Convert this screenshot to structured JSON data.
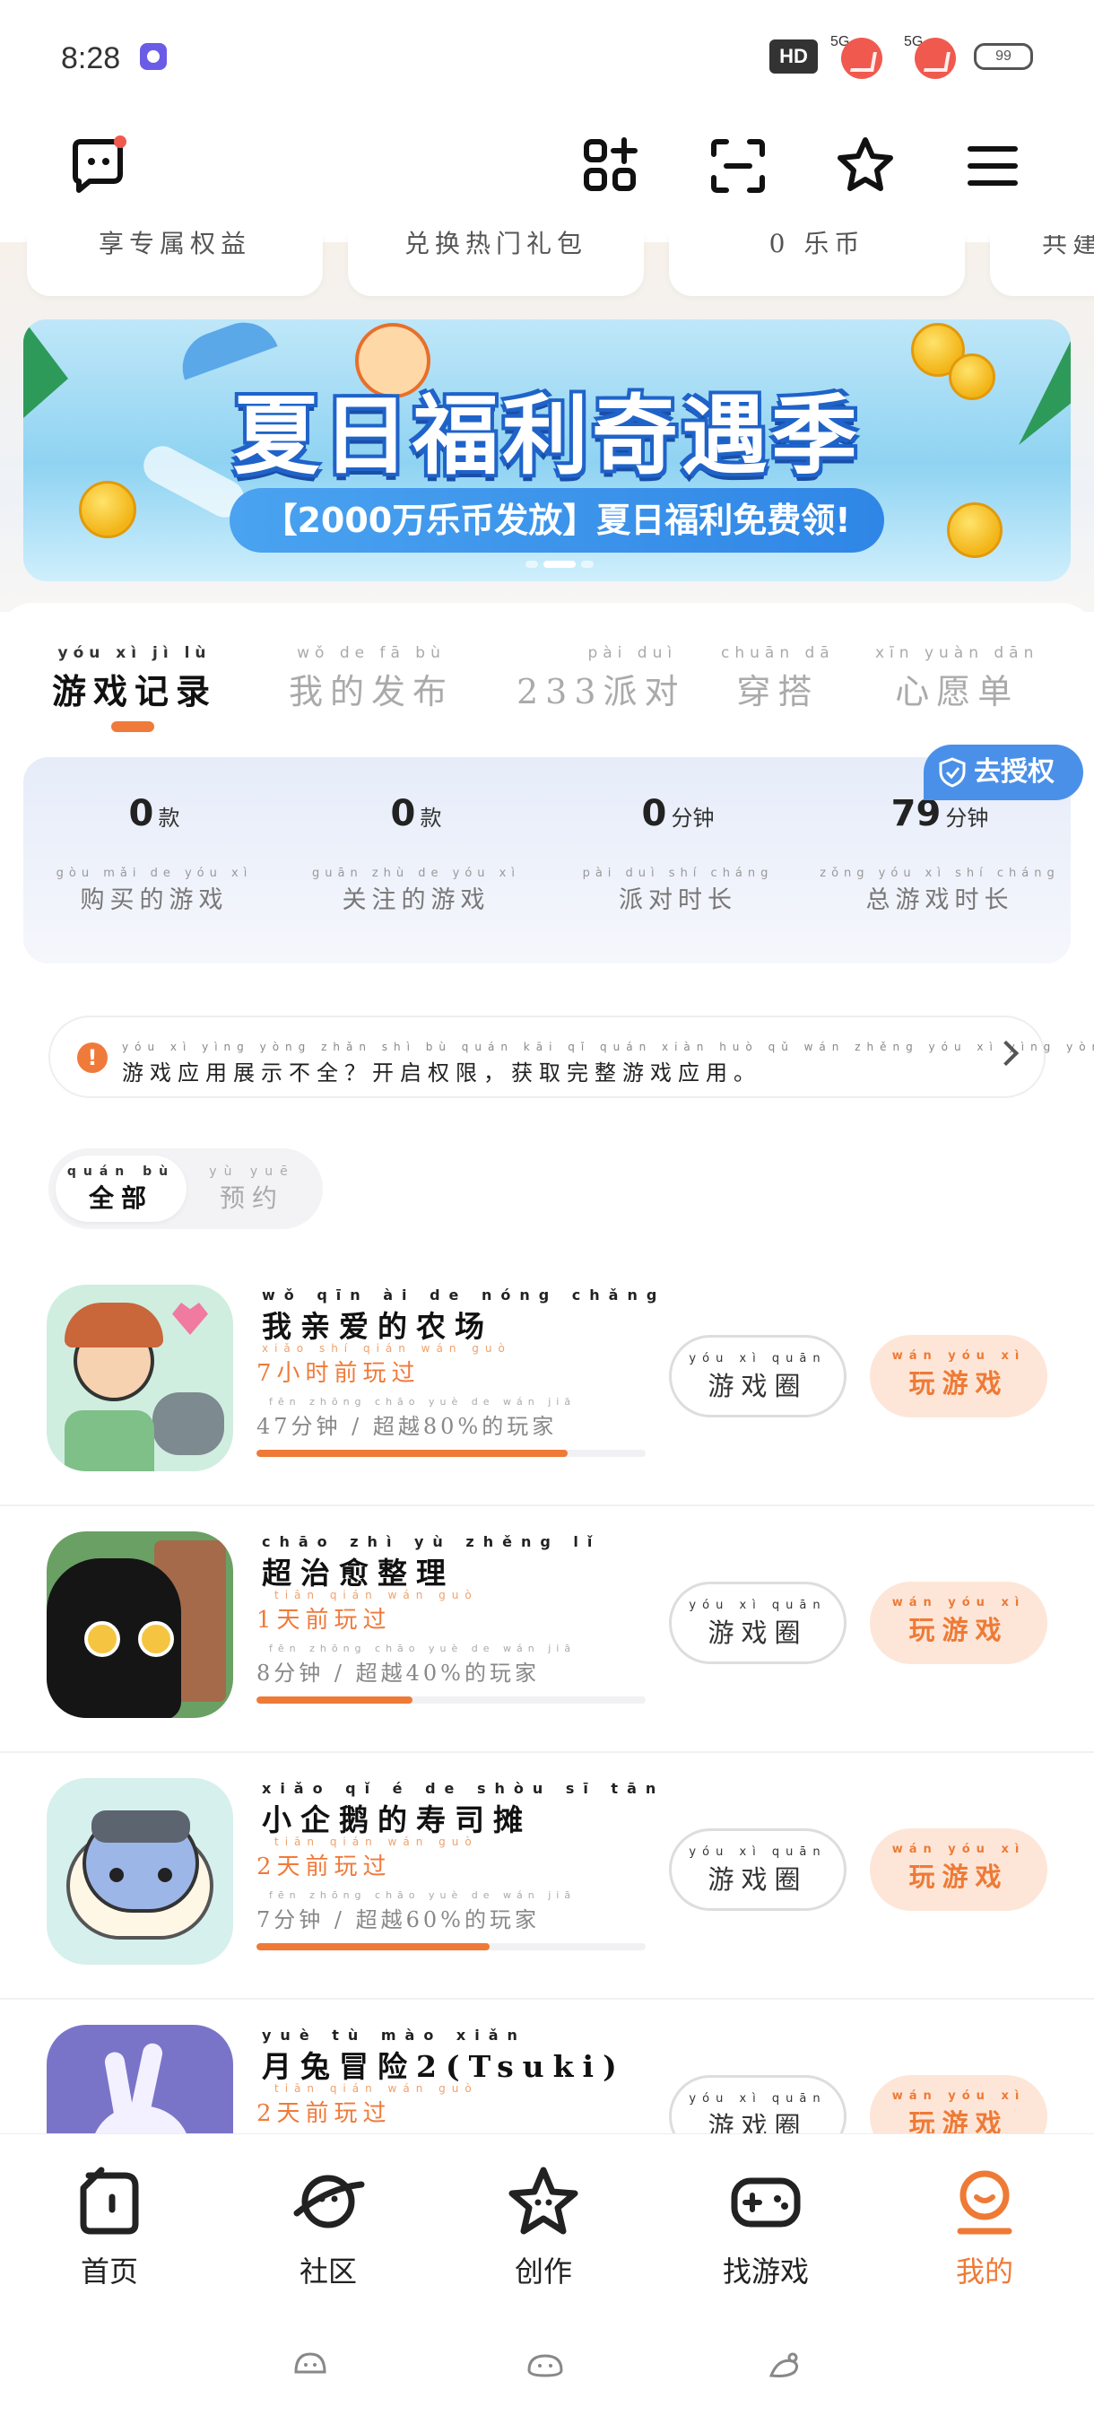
{
  "status_bar": {
    "time": "8:28",
    "hd": "HD",
    "signal_1": "5G",
    "signal_2": "5G",
    "battery": "99"
  },
  "quick_links": [
    {
      "label": "享专属权益"
    },
    {
      "label": "兑换热门礼包"
    },
    {
      "label": "0 乐币"
    },
    {
      "label": "共建"
    }
  ],
  "banner": {
    "title": "夏日福利奇遇季",
    "subtitle": "【2000万乐币发放】夏日福利免费领!"
  },
  "tabs": [
    {
      "pinyin": "yóu xì jì lù",
      "label": "游戏记录",
      "active": true
    },
    {
      "pinyin": "wǒ de fā bù",
      "label": "我的发布",
      "active": false
    },
    {
      "pinyin": "pài duì",
      "label": "233派对",
      "active": false
    },
    {
      "pinyin": "chuān dā",
      "label": "穿搭",
      "active": false
    },
    {
      "pinyin": "xīn yuàn dān",
      "label": "心愿单",
      "active": false
    }
  ],
  "authorize": {
    "label": "去授权"
  },
  "stats": [
    {
      "value": "0",
      "unit": "款",
      "unit_py": "kuǎn",
      "label_py": "gòu mǎi de yóu xì",
      "label": "购买的游戏"
    },
    {
      "value": "0",
      "unit": "款",
      "unit_py": "kuǎn",
      "label_py": "guān zhù de yóu xì",
      "label": "关注的游戏"
    },
    {
      "value": "0",
      "unit": "分钟",
      "unit_py": "fēn zhōng",
      "label_py": "pài duì shí cháng",
      "label": "派对时长"
    },
    {
      "value": "79",
      "unit": "分钟",
      "unit_py": "fēn zhōng",
      "label_py": "zǒng yóu xì shí cháng",
      "label": "总游戏时长"
    }
  ],
  "permission": {
    "pinyin": "yóu xì yìng yòng zhǎn shì bù quán   kāi qǐ quán xiàn   huò qǔ wán zhěng yóu xì yìng yòng",
    "text": "游戏应用展示不全？开启权限，获取完整游戏应用。"
  },
  "filter": [
    {
      "pinyin": "quán bù",
      "label": "全部",
      "active": true
    },
    {
      "pinyin": "yù yuē",
      "label": "预约",
      "active": false
    }
  ],
  "games": [
    {
      "title_py": "wǒ qīn ài de nóng chǎng",
      "title": "我亲爱的农场",
      "time_py": "xiǎo shí qián wán guò",
      "time": "7小时前玩过",
      "stat_py": "fēn zhōng   chāo yuè     de wán jiā",
      "stat": "47分钟 / 超越80%的玩家",
      "progress": 0.8
    },
    {
      "title_py": "chāo zhì yù zhěng lǐ",
      "title": "超治愈整理",
      "time_py": "tiān qián wán guò",
      "time": "1天前玩过",
      "stat_py": "fēn zhōng   chāo yuè     de wán jiā",
      "stat": "8分钟 / 超越40%的玩家",
      "progress": 0.4
    },
    {
      "title_py": "xiǎo qǐ é de shòu sī tān",
      "title": "小企鹅的寿司摊",
      "time_py": "tiān qián wán guò",
      "time": "2天前玩过",
      "stat_py": "fēn zhōng   chāo yuè     de wán jiā",
      "stat": "7分钟 / 超越60%的玩家",
      "progress": 0.6
    },
    {
      "title_py": "yuè tù mào xiǎn",
      "title": "月兔冒险2(Tsuki)",
      "time_py": "tiān qián wán guò",
      "time": "2天前玩过",
      "stat_py": "",
      "stat": "",
      "progress": 0
    }
  ],
  "game_buttons": {
    "circle_py": "yóu xì quān",
    "circle": "游戏圈",
    "play_py": "wán yóu xì",
    "play": "玩游戏"
  },
  "bottom_nav": [
    {
      "label": "首页",
      "icon": "home-icon"
    },
    {
      "label": "社区",
      "icon": "planet-icon"
    },
    {
      "label": "创作",
      "icon": "star-icon"
    },
    {
      "label": "找游戏",
      "icon": "gamepad-icon"
    },
    {
      "label": "我的",
      "icon": "profile-icon",
      "active": true
    }
  ],
  "colors": {
    "accent": "#ee7a36",
    "authorize_blue": "#4a90e8"
  }
}
